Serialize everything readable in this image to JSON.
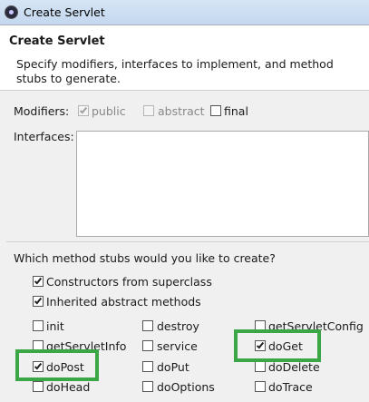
{
  "window": {
    "title": "Create Servlet"
  },
  "header": {
    "title": "Create Servlet",
    "description": "Specify modifiers, interfaces to implement, and method stubs to generate."
  },
  "modifiers": {
    "label": "Modifiers:",
    "public": {
      "label": "public",
      "checked": true,
      "enabled": false
    },
    "abstract": {
      "label": "abstract",
      "checked": false,
      "enabled": false
    },
    "final": {
      "label": "final",
      "checked": false,
      "enabled": true
    }
  },
  "interfaces": {
    "label": "Interfaces:"
  },
  "stubs": {
    "question": "Which method stubs would you like to create?",
    "constructors": {
      "label": "Constructors from superclass",
      "checked": true
    },
    "inherited": {
      "label": "Inherited abstract methods",
      "checked": true
    },
    "methods": {
      "init": {
        "label": "init",
        "checked": false
      },
      "destroy": {
        "label": "destroy",
        "checked": false
      },
      "getServletConfig": {
        "label": "getServletConfig",
        "checked": false
      },
      "getServletInfo": {
        "label": "getServletInfo",
        "checked": false
      },
      "service": {
        "label": "service",
        "checked": false
      },
      "doGet": {
        "label": "doGet",
        "checked": true
      },
      "doPost": {
        "label": "doPost",
        "checked": true
      },
      "doPut": {
        "label": "doPut",
        "checked": false
      },
      "doDelete": {
        "label": "doDelete",
        "checked": false
      },
      "doHead": {
        "label": "doHead",
        "checked": false
      },
      "doOptions": {
        "label": "doOptions",
        "checked": false
      },
      "doTrace": {
        "label": "doTrace",
        "checked": false
      }
    }
  },
  "colors": {
    "highlight": "#3aa645",
    "titlebar": "#c3d7ee"
  }
}
